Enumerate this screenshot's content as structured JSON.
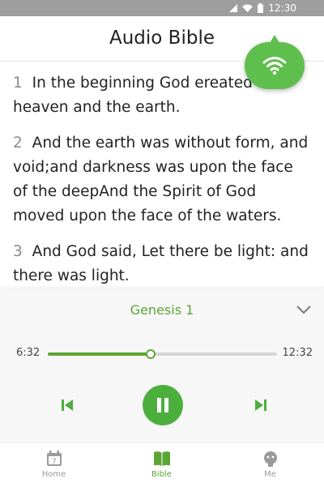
{
  "status_bar": {
    "time": "12:30"
  },
  "header": {
    "title": "Audio Bible"
  },
  "verses": [
    {
      "num": "1",
      "text": "In the beginning God ereated the heaven and the earth."
    },
    {
      "num": "2",
      "text": "And the earth was without form, and void;and darkness was upon the face of the deepAnd the Spirit of God moved upon the face of the waters."
    },
    {
      "num": "3",
      "text": "And God said, Let there be light: and there was light."
    }
  ],
  "player": {
    "chapter": "Genesis 1",
    "current_time": "6:32",
    "total_time": "12:32",
    "progress": 0.45
  },
  "bottom_nav": {
    "items": [
      {
        "label": "Home",
        "icon": "calendar-icon"
      },
      {
        "label": "Bible",
        "icon": "book-icon"
      },
      {
        "label": "Me",
        "icon": "profile-icon"
      }
    ],
    "active": "Bible"
  },
  "colors": {
    "accent": "#5ba534",
    "fab": "#5fbf4d",
    "status_bar": "#9e9e9e"
  }
}
